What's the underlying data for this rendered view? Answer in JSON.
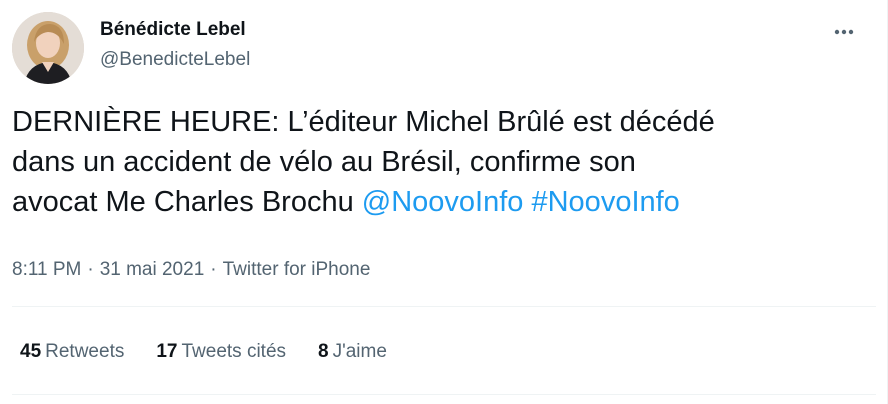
{
  "author": {
    "display_name": "Bénédicte Lebel",
    "handle": "@BenedicteLebel",
    "avatar_icon": "profile-photo"
  },
  "more_icon": "more-horizontal-icon",
  "tweet": {
    "text": "DERNIÈRE HEURE: L’éditeur Michel Brûlé est décédé\ndans un accident de vélo au Brésil, confirme son\navocat Me Charles Brochu ",
    "mention": "@NoovoInfo",
    "hashtag": "#NoovoInfo"
  },
  "meta": {
    "time": "8:11 PM",
    "separator": "·",
    "date": "31 mai 2021",
    "source": "Twitter for iPhone"
  },
  "stats": {
    "retweets_count": "45",
    "retweets_label": "Retweets",
    "quotes_count": "17",
    "quotes_label": "Tweets cités",
    "likes_count": "8",
    "likes_label": "J'aime"
  },
  "colors": {
    "link": "#1d9bf0",
    "text": "#0f1419",
    "secondary": "#536471",
    "divider": "#eff3f4"
  }
}
